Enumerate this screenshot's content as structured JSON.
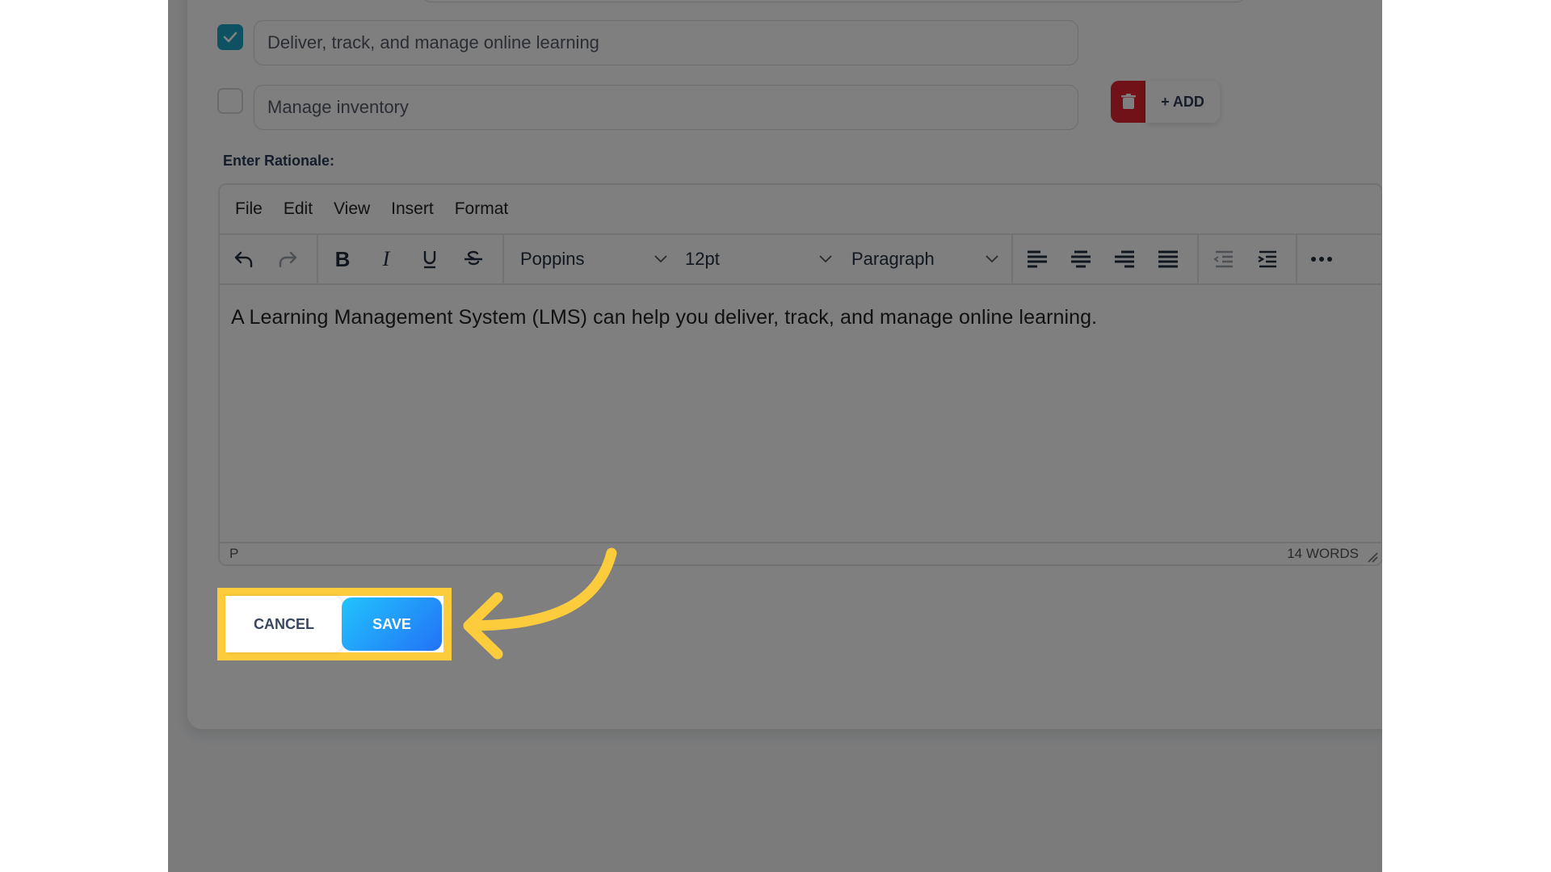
{
  "options": [
    {
      "label": "Deliver, track, and manage online learning",
      "checked": true
    },
    {
      "label": "Manage inventory",
      "checked": false
    }
  ],
  "option_actions": {
    "delete_icon": "trash-icon",
    "add_label": "+ ADD"
  },
  "rationale": {
    "label": "Enter Rationale:",
    "menu": [
      "File",
      "Edit",
      "View",
      "Insert",
      "Format"
    ],
    "toolbar": {
      "font": "Poppins",
      "size": "12pt",
      "block": "Paragraph",
      "icons": [
        "undo-icon",
        "redo-icon",
        "bold-icon",
        "italic-icon",
        "underline-icon",
        "strikethrough-icon",
        "align-left-icon",
        "align-center-icon",
        "align-right-icon",
        "align-justify-icon",
        "outdent-icon",
        "indent-icon",
        "more-icon"
      ]
    },
    "content": "A Learning Management System (LMS) can help you deliver, track, and manage online learning.",
    "status_path": "P",
    "word_count": "14 WORDS"
  },
  "actions": {
    "cancel_label": "CANCEL",
    "save_label": "SAVE"
  },
  "colors": {
    "highlight": "#fdcc3c",
    "checkbox_on": "#1aa3c4",
    "delete": "#e0242e",
    "save_from": "#21c3fc",
    "save_to": "#2372f6"
  }
}
